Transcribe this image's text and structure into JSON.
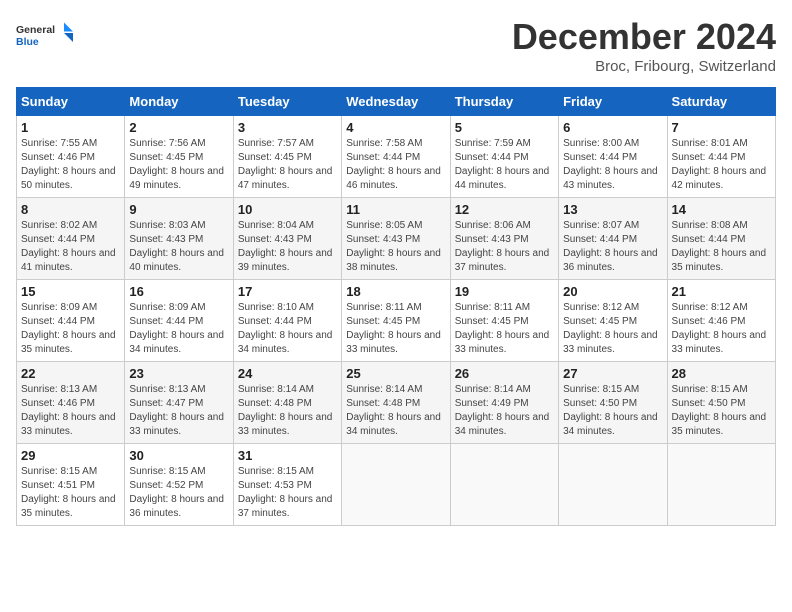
{
  "logo": {
    "line1": "General",
    "line2": "Blue"
  },
  "title": "December 2024",
  "subtitle": "Broc, Fribourg, Switzerland",
  "weekdays": [
    "Sunday",
    "Monday",
    "Tuesday",
    "Wednesday",
    "Thursday",
    "Friday",
    "Saturday"
  ],
  "weeks": [
    [
      {
        "day": "1",
        "sunrise": "7:55 AM",
        "sunset": "4:46 PM",
        "daylight": "8 hours and 50 minutes."
      },
      {
        "day": "2",
        "sunrise": "7:56 AM",
        "sunset": "4:45 PM",
        "daylight": "8 hours and 49 minutes."
      },
      {
        "day": "3",
        "sunrise": "7:57 AM",
        "sunset": "4:45 PM",
        "daylight": "8 hours and 47 minutes."
      },
      {
        "day": "4",
        "sunrise": "7:58 AM",
        "sunset": "4:44 PM",
        "daylight": "8 hours and 46 minutes."
      },
      {
        "day": "5",
        "sunrise": "7:59 AM",
        "sunset": "4:44 PM",
        "daylight": "8 hours and 44 minutes."
      },
      {
        "day": "6",
        "sunrise": "8:00 AM",
        "sunset": "4:44 PM",
        "daylight": "8 hours and 43 minutes."
      },
      {
        "day": "7",
        "sunrise": "8:01 AM",
        "sunset": "4:44 PM",
        "daylight": "8 hours and 42 minutes."
      }
    ],
    [
      {
        "day": "8",
        "sunrise": "8:02 AM",
        "sunset": "4:44 PM",
        "daylight": "8 hours and 41 minutes."
      },
      {
        "day": "9",
        "sunrise": "8:03 AM",
        "sunset": "4:43 PM",
        "daylight": "8 hours and 40 minutes."
      },
      {
        "day": "10",
        "sunrise": "8:04 AM",
        "sunset": "4:43 PM",
        "daylight": "8 hours and 39 minutes."
      },
      {
        "day": "11",
        "sunrise": "8:05 AM",
        "sunset": "4:43 PM",
        "daylight": "8 hours and 38 minutes."
      },
      {
        "day": "12",
        "sunrise": "8:06 AM",
        "sunset": "4:43 PM",
        "daylight": "8 hours and 37 minutes."
      },
      {
        "day": "13",
        "sunrise": "8:07 AM",
        "sunset": "4:44 PM",
        "daylight": "8 hours and 36 minutes."
      },
      {
        "day": "14",
        "sunrise": "8:08 AM",
        "sunset": "4:44 PM",
        "daylight": "8 hours and 35 minutes."
      }
    ],
    [
      {
        "day": "15",
        "sunrise": "8:09 AM",
        "sunset": "4:44 PM",
        "daylight": "8 hours and 35 minutes."
      },
      {
        "day": "16",
        "sunrise": "8:09 AM",
        "sunset": "4:44 PM",
        "daylight": "8 hours and 34 minutes."
      },
      {
        "day": "17",
        "sunrise": "8:10 AM",
        "sunset": "4:44 PM",
        "daylight": "8 hours and 34 minutes."
      },
      {
        "day": "18",
        "sunrise": "8:11 AM",
        "sunset": "4:45 PM",
        "daylight": "8 hours and 33 minutes."
      },
      {
        "day": "19",
        "sunrise": "8:11 AM",
        "sunset": "4:45 PM",
        "daylight": "8 hours and 33 minutes."
      },
      {
        "day": "20",
        "sunrise": "8:12 AM",
        "sunset": "4:45 PM",
        "daylight": "8 hours and 33 minutes."
      },
      {
        "day": "21",
        "sunrise": "8:12 AM",
        "sunset": "4:46 PM",
        "daylight": "8 hours and 33 minutes."
      }
    ],
    [
      {
        "day": "22",
        "sunrise": "8:13 AM",
        "sunset": "4:46 PM",
        "daylight": "8 hours and 33 minutes."
      },
      {
        "day": "23",
        "sunrise": "8:13 AM",
        "sunset": "4:47 PM",
        "daylight": "8 hours and 33 minutes."
      },
      {
        "day": "24",
        "sunrise": "8:14 AM",
        "sunset": "4:48 PM",
        "daylight": "8 hours and 33 minutes."
      },
      {
        "day": "25",
        "sunrise": "8:14 AM",
        "sunset": "4:48 PM",
        "daylight": "8 hours and 34 minutes."
      },
      {
        "day": "26",
        "sunrise": "8:14 AM",
        "sunset": "4:49 PM",
        "daylight": "8 hours and 34 minutes."
      },
      {
        "day": "27",
        "sunrise": "8:15 AM",
        "sunset": "4:50 PM",
        "daylight": "8 hours and 34 minutes."
      },
      {
        "day": "28",
        "sunrise": "8:15 AM",
        "sunset": "4:50 PM",
        "daylight": "8 hours and 35 minutes."
      }
    ],
    [
      {
        "day": "29",
        "sunrise": "8:15 AM",
        "sunset": "4:51 PM",
        "daylight": "8 hours and 35 minutes."
      },
      {
        "day": "30",
        "sunrise": "8:15 AM",
        "sunset": "4:52 PM",
        "daylight": "8 hours and 36 minutes."
      },
      {
        "day": "31",
        "sunrise": "8:15 AM",
        "sunset": "4:53 PM",
        "daylight": "8 hours and 37 minutes."
      },
      null,
      null,
      null,
      null
    ]
  ]
}
